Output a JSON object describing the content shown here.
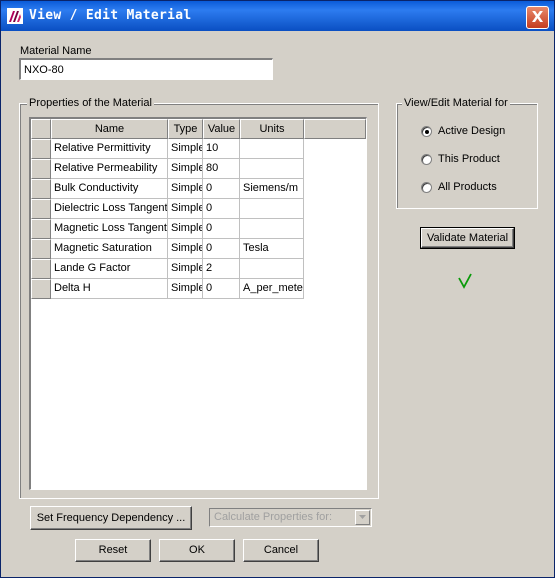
{
  "window": {
    "title": "View / Edit Material",
    "close_label": "X"
  },
  "material_name": {
    "label": "Material Name",
    "value": "NXO-80"
  },
  "properties": {
    "group_title": "Properties of the Material",
    "columns": [
      "Name",
      "Type",
      "Value",
      "Units"
    ],
    "rows": [
      {
        "name": "Relative Permittivity",
        "type": "Simple",
        "value": "10",
        "units": ""
      },
      {
        "name": "Relative Permeability",
        "type": "Simple",
        "value": "80",
        "units": ""
      },
      {
        "name": "Bulk Conductivity",
        "type": "Simple",
        "value": "0",
        "units": "Siemens/m"
      },
      {
        "name": "Dielectric Loss Tangent",
        "type": "Simple",
        "value": "0",
        "units": ""
      },
      {
        "name": "Magnetic Loss Tangent",
        "type": "Simple",
        "value": "0",
        "units": ""
      },
      {
        "name": "Magnetic Saturation",
        "type": "Simple",
        "value": "0",
        "units": "Tesla"
      },
      {
        "name": "Lande G Factor",
        "type": "Simple",
        "value": "2",
        "units": ""
      },
      {
        "name": "Delta H",
        "type": "Simple",
        "value": "0",
        "units": "A_per_meter"
      }
    ]
  },
  "view_edit_for": {
    "group_title": "View/Edit Material for",
    "options": [
      "Active Design",
      "This Product",
      "All Products"
    ],
    "selected": "Active Design"
  },
  "validate_button": "Validate Material",
  "validation_status": "valid",
  "frequency_button": "Set Frequency Dependency ...",
  "calculate_select": {
    "value": "Calculate Properties for:",
    "disabled": true
  },
  "buttons": {
    "reset": "Reset",
    "ok": "OK",
    "cancel": "Cancel"
  },
  "colors": {
    "titlebar": "#0a5bd9",
    "dialog_bg": "#d4d0c8",
    "check": "#0a9a0a"
  }
}
